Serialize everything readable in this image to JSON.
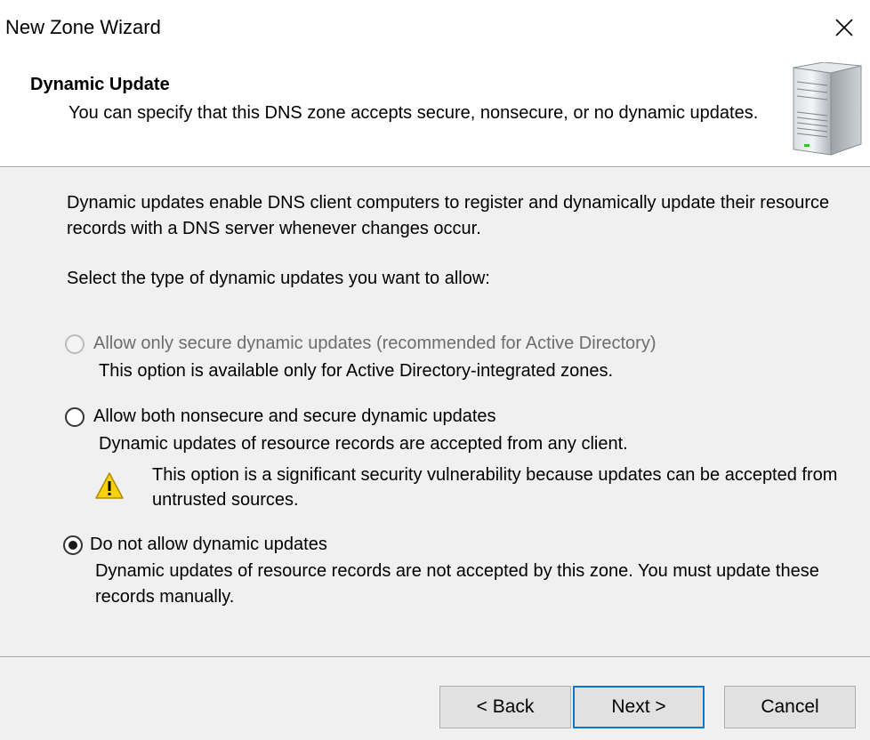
{
  "window": {
    "title": "New Zone Wizard",
    "close_icon": "close-icon"
  },
  "header": {
    "title": "Dynamic Update",
    "description": "You can specify that this DNS zone accepts secure, nonsecure, or no dynamic updates.",
    "icon": "server-icon"
  },
  "body": {
    "intro": "Dynamic updates enable DNS client computers to register and dynamically update their resource records with a DNS server whenever changes occur.",
    "select_label": "Select the type of dynamic updates you want to allow:"
  },
  "options": [
    {
      "label": "Allow only secure dynamic updates (recommended for Active Directory)",
      "description": "This option is available only for Active Directory-integrated zones.",
      "selected": false,
      "enabled": false
    },
    {
      "label": "Allow both nonsecure and secure dynamic updates",
      "description": "Dynamic updates of resource records are accepted from any client.",
      "warning": "This option is a significant security vulnerability because updates can be accepted from untrusted sources.",
      "warning_icon": "warning-icon",
      "selected": false,
      "enabled": true
    },
    {
      "label": "Do not allow dynamic updates",
      "description": "Dynamic updates of resource records are not accepted by this zone. You must update these records manually.",
      "selected": true,
      "enabled": true
    }
  ],
  "buttons": {
    "back": "< Back",
    "next": "Next >",
    "cancel": "Cancel"
  },
  "colors": {
    "default_button_border": "#0078d7",
    "warning_yellow": "#f6d10c",
    "disabled_text": "#6d6d6d"
  }
}
